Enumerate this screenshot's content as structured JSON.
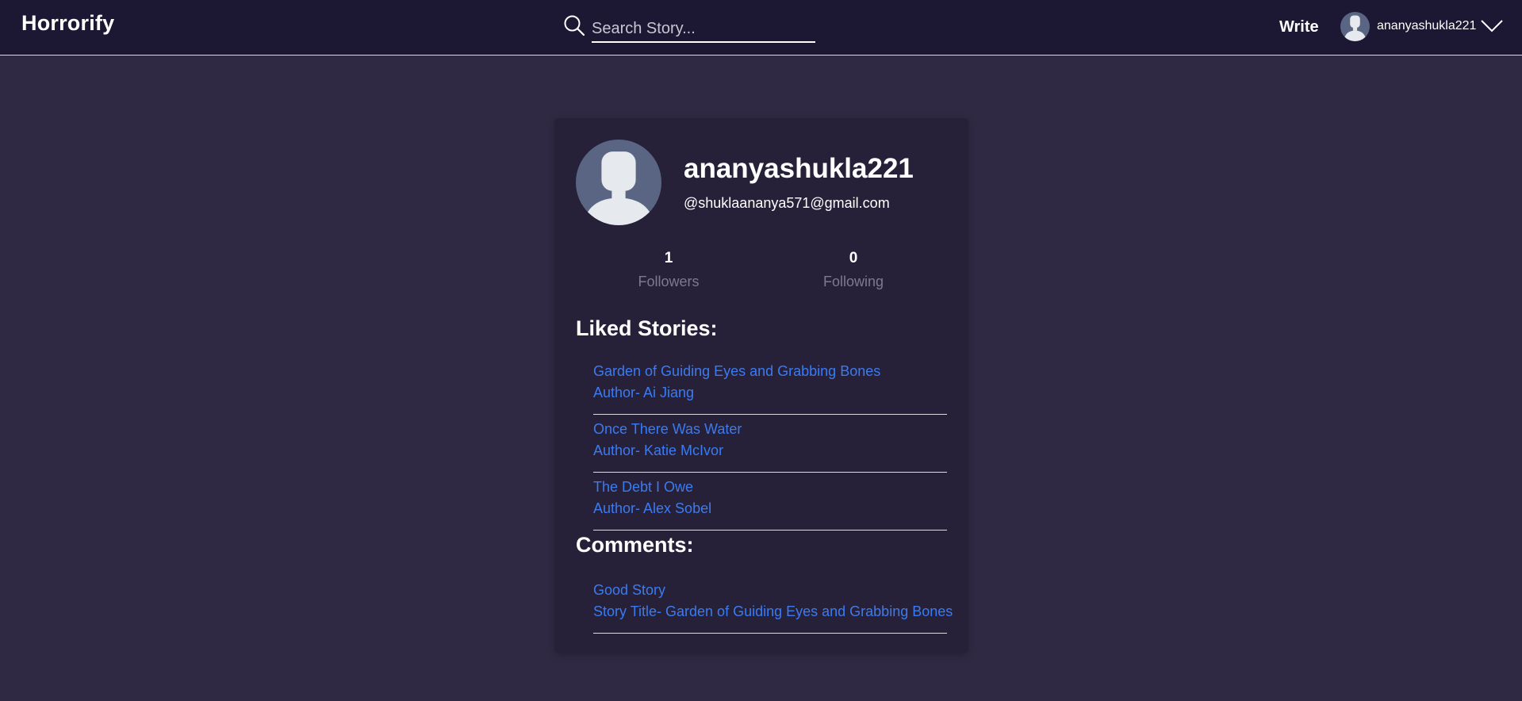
{
  "brand": {
    "name": "Horrorify"
  },
  "search": {
    "placeholder": "Search Story..."
  },
  "nav": {
    "write_label": "Write",
    "username": "ananyashukla221"
  },
  "profile": {
    "name": "ananyashukla221",
    "email": "@shuklaananya571@gmail.com",
    "followers_count": "1",
    "followers_label": "Followers",
    "following_count": "0",
    "following_label": "Following"
  },
  "liked": {
    "heading": "Liked Stories:",
    "items": [
      {
        "title": "Garden of Guiding Eyes and Grabbing Bones",
        "author": "Author- Ai Jiang"
      },
      {
        "title": "Once There Was Water",
        "author": "Author- Katie McIvor"
      },
      {
        "title": "The Debt I Owe",
        "author": "Author- Alex Sobel"
      }
    ]
  },
  "comments": {
    "heading": "Comments:",
    "items": [
      {
        "text": "Good Story",
        "story": "Story Title- Garden of Guiding Eyes and Grabbing Bones"
      }
    ]
  },
  "colors": {
    "background": "#302944",
    "navbar": "#1c1732",
    "card": "#262139",
    "link": "#3b7bf1",
    "muted": "#7d7894"
  }
}
